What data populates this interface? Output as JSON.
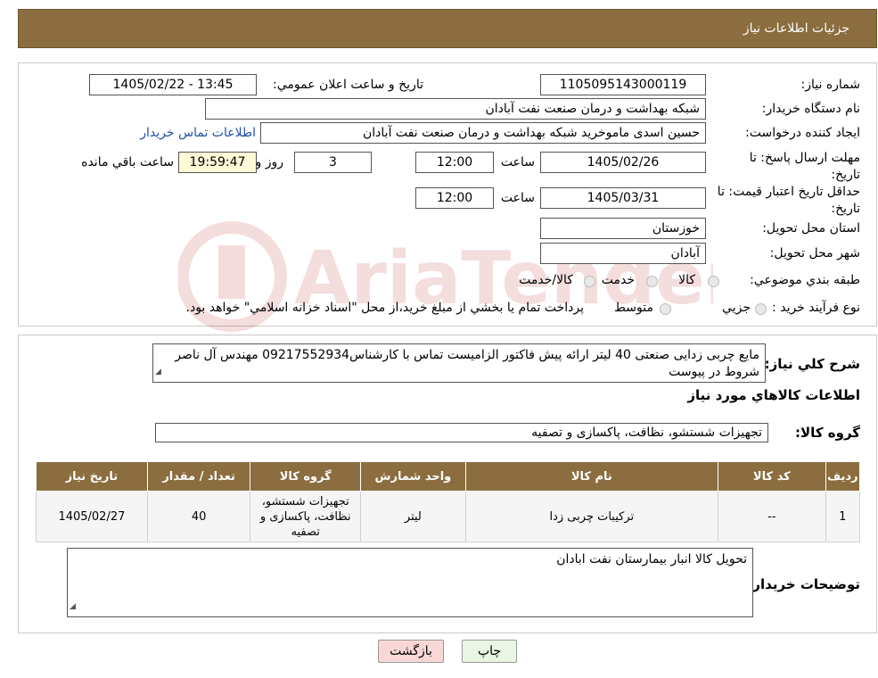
{
  "header": {
    "title": "جزئیات اطلاعات نیاز"
  },
  "form": {
    "need_number_label": "شماره نياز:",
    "need_number": "1105095143000119",
    "announce_label": "تاريخ و ساعت اعلان عمومي:",
    "announce_value": "1405/02/22 - 13:45",
    "buyer_org_label": "نام دستگاه خريدار:",
    "buyer_org": "شبکه بهداشت و درمان صنعت نفت آبادان",
    "requester_label": "ايجاد کننده درخواست:",
    "requester": "حسین اسدی ماموخرید شبکه بهداشت و درمان صنعت نفت آبادان",
    "contact_link": "اطلاعات تماس خريدار",
    "deadline_label": "مهلت ارسال پاسخ: تا تاريخ:",
    "deadline_date": "1405/02/26",
    "time_label": "ساعت",
    "deadline_time": "12:00",
    "days": "3",
    "days_label": "روز و",
    "remaining_time": "19:59:47",
    "remaining_label": "ساعت باقي مانده",
    "validity_label": "حداقل تاريخ اعتبار قيمت: تا تاريخ:",
    "validity_date": "1405/03/31",
    "validity_time": "12:00",
    "province_label": "استان محل تحويل:",
    "province": "خوزستان",
    "city_label": "شهر محل تحويل:",
    "city": "آبادان",
    "category_label": "طبقه بندي موضوعي:",
    "category_options": [
      "کالا",
      "خدمت",
      "کالا/خدمت"
    ],
    "process_label": "نوع فرآيند خريد :",
    "process_options": [
      "جزيي",
      "متوسط"
    ],
    "process_note": "پرداخت تمام يا بخشي از مبلغ خريد،از محل \"اسناد خزانه اسلامي\" خواهد بود."
  },
  "summary": {
    "label": "شرح کلي نياز:",
    "text": "مایع چربی زدایی صنعتی 40 لیتر ارائه پیش فاکتور الزامیست تماس با کارشناس09217552934 مهندس آل ناصر شروط در پیوست",
    "goods_info_title": "اطلاعات کالاهاي مورد نياز",
    "goods_group_label": "گروه کالا:",
    "goods_group": "تجهیزات شستشو، نظافت، پاکسازی و تصفیه"
  },
  "table": {
    "headers": [
      "رديف",
      "کد کالا",
      "نام کالا",
      "واحد شمارش",
      "گروه کالا",
      "تعداد / مقدار",
      "تاريخ نياز"
    ],
    "rows": [
      [
        "1",
        "--",
        "ترکیبات چربی زدا",
        "لیتر",
        "تجهیزات شستشو، نظافت، پاکسازی و تصفیه",
        "40",
        "1405/02/27"
      ]
    ]
  },
  "buyer_notes": {
    "label": "توضيحات خريدار:",
    "text": "تحویل کالا انبار بیمارستان نفت ابادان"
  },
  "buttons": {
    "print": "چاپ",
    "back": "بازگشت"
  },
  "watermark": {
    "text": "AriaTender.neT"
  },
  "colors": {
    "header_bg": "#8b6d3f",
    "back_button_bg": "#f9d7d7",
    "print_button_bg": "#eaf6e4",
    "timer_bg": "#fff9d7",
    "link": "#1f4fa8"
  }
}
